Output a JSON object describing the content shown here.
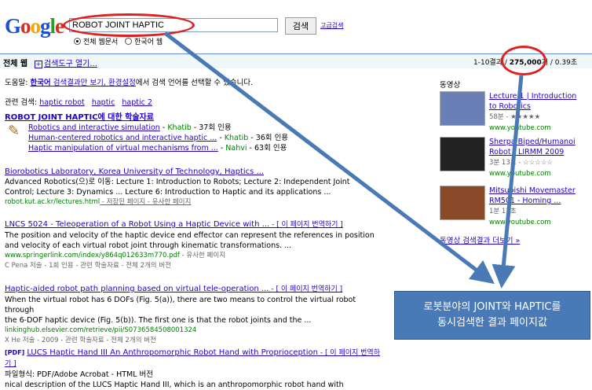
{
  "logo": {
    "letters": [
      "G",
      "o",
      "o",
      "g",
      "l",
      "e"
    ]
  },
  "search": {
    "query": "ROBOT JOINT HAPTIC",
    "button": "검색",
    "advanced": "고급검색",
    "radio_all": "전체 웹문서",
    "radio_korean": "한국어 웹"
  },
  "toolbar": {
    "label": "전체 웹",
    "tools": "검색도구 열기...",
    "stats_prefix": "1-10결과 / ",
    "count": "275,000",
    "stats_suffix": "개 / 0.39초"
  },
  "tip": {
    "prefix": "도움말: ",
    "link1": "한국어",
    "mid1": " 검색결과만 보기, ",
    "link2": "환경설정",
    "suffix": "에서 검색 언어를 선택할 수 있습니다."
  },
  "related": {
    "label": "관련 검색: ",
    "items": [
      "haptic robot",
      "haptic",
      "haptic 2"
    ]
  },
  "scholar": {
    "title": "ROBOT JOINT HAPTIC에 대한 학술자료",
    "items": [
      {
        "title": "Robotics and interactive simulation",
        "author": "Khatib",
        "cite": "37회 인용"
      },
      {
        "title": "Human-centered robotics and interactive haptic ...",
        "author": "Khatib",
        "cite": "36회 인용"
      },
      {
        "title": "Haptic manipulation of virtual mechanisms from ...",
        "author": "Nahvi",
        "cite": "63회 인용"
      }
    ]
  },
  "results": [
    {
      "title": "Biorobotics Laboratory, Korea University of Technology, Haptics ...",
      "line1": "Advanced Robotics(으)로 이동: Lecture 1: Introduction to Robots; Lecture 2: Independent Joint",
      "line2": "Control; Lecture 3: Dynamics ... Lecture 6: Introduction to Haptic and its applications ...",
      "url": "robot.kut.ac.kr/lectures.html",
      "extra": " - 저장된 페이지 - 유사한 페이지"
    },
    {
      "title": "LNCS 5024 - Teleoperation of a Robot Using a Haptic Device with ...",
      "translate": " - [ 이 페이지 번역하기 ]",
      "line1": "The position and velocity of the haptic device end effector can represent the references in position",
      "line2": "and velocity of each virtual robot joint through kinematic transformations. ...",
      "url": "www.springerlink.com/index/y864q012633m770.pdf",
      "extra": " - 유사한 페이지",
      "meta": "C Pena 저술 - 1회 인용 - 관련 학술자료 - 전체 2개의 버전"
    },
    {
      "title": "Haptic-aided robot path planning based on virtual tele-operation ...",
      "translate": " - [ 이 페이지 번역하기 ]",
      "line1": "When the virtual robot has 6 DOFs (Fig. 5(a)), there are two means to control the virtual robot through",
      "line2": "the 6-DOF haptic device (Fig. 5(b)). The first one is that the robot joints and the ...",
      "url": "linkinghub.elsevier.com/retrieve/pii/S0736584508001324",
      "extra": "",
      "meta": "X He 저술 - 2009 - 관련 학술자료 - 전체 2개의 버전"
    },
    {
      "tag": "[PDF]",
      "title": "LUCS Haptic Hand III An Anthropomorphic Robot Hand with Proprioception",
      "translate": " - [ 이 페이지 번역하기 ]",
      "line1": "파일형식: PDF/Adobe Acrobat - HTML 버전",
      "line2": "nical description of the LUCS Haptic Hand III, which is an anthropomorphic robot hand with"
    }
  ],
  "videos": {
    "header": "동영상",
    "items": [
      {
        "title1": "Lecture 1 | Introduction",
        "title2": "to Robotics",
        "meta": "58분 - ★★★★★",
        "url": "www.youtube.com"
      },
      {
        "title1": "Sherpa Biped/Humanoi",
        "title2": "Robot - LIRMM 2009",
        "meta": "3분 13초 - ☆☆☆☆☆",
        "url": "www.youtube.com"
      },
      {
        "title1": "Mitsubishi Movemaster",
        "title2": "RM501 - Homing ...",
        "meta": "1분 11초",
        "url": "www.youtube.com"
      }
    ],
    "more": "동영상 검색결과 더보기 »"
  },
  "callout": {
    "line1": "로봇분야의 JOINT와 HAPTIC를",
    "line2": "동시검색한 결과 페이지값"
  },
  "colors": {
    "annotation_red": "#e02020",
    "arrow_blue": "#4a7ab5"
  }
}
